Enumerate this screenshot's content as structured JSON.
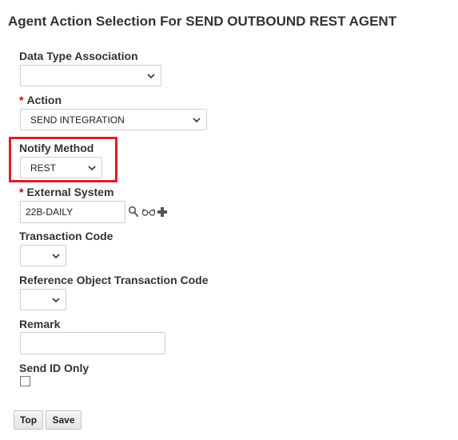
{
  "header": {
    "title": "Agent Action Selection For SEND OUTBOUND REST AGENT"
  },
  "form": {
    "data_type_association": {
      "label": "Data Type Association",
      "value": ""
    },
    "action": {
      "required_marker": "*",
      "label": "Action",
      "value": "SEND INTEGRATION"
    },
    "notify_method": {
      "label": "Notify Method",
      "value": "REST"
    },
    "external_system": {
      "required_marker": "*",
      "label": "External System",
      "value": "22B-DAILY",
      "icons": [
        "search-icon",
        "view-details-icon",
        "add-icon"
      ]
    },
    "transaction_code": {
      "label": "Transaction Code",
      "value": ""
    },
    "reference_object_transaction_code": {
      "label": "Reference Object Transaction Code",
      "value": ""
    },
    "remark": {
      "label": "Remark",
      "value": ""
    },
    "send_id_only": {
      "label": "Send ID Only",
      "checked": false
    }
  },
  "buttons": {
    "top_label": "Top",
    "save_label": "Save"
  },
  "colors": {
    "highlight": "#e01b24",
    "required": "#cc0000",
    "text": "#333333"
  }
}
